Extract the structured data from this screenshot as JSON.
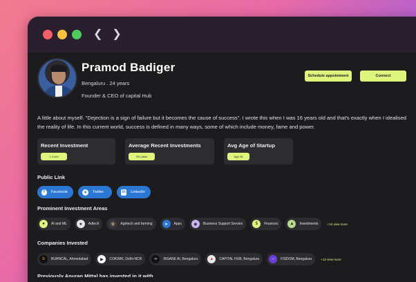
{
  "profile": {
    "name": "Pramod Badiger",
    "meta": "Bengaluru . 24 years",
    "role": "Founder & CEO of capital Hub"
  },
  "actions": {
    "schedule_label": "Schedule appointment",
    "connect_label": "Connect"
  },
  "bio": "A little about myself. \"Dejection is a sign of failure but it becomes the cause of success\". I wrote this when I was 16 years old and that's exactly when I idealised the reality of life. In this current world, success is defined in many ways, some of which include money, fame and power.",
  "stats": [
    {
      "label": "Recent Investment",
      "value": "1 Crore"
    },
    {
      "label": "Average Recent Investments",
      "value": "25 Lakhs"
    },
    {
      "label": "Avg Age of Startup",
      "value": "Age 25"
    }
  ],
  "public_link": {
    "title": "Public Link",
    "items": [
      {
        "label": "Facebook",
        "icon": "facebook-icon"
      },
      {
        "label": "Twitter",
        "icon": "twitter-icon"
      },
      {
        "label": "LinkedIn",
        "icon": "linkedin-icon"
      }
    ]
  },
  "investment_areas": {
    "title": "Prominent Investment Areas",
    "items": [
      {
        "label": "AI and ML",
        "icon": "ai-icon",
        "color": "#ddf57b"
      },
      {
        "label": "Adtech",
        "icon": "adtech-icon",
        "color": "#e6e6ea"
      },
      {
        "label": "Agritech and farming",
        "icon": "agritech-icon",
        "color": "#3a3a40"
      },
      {
        "label": "Apps",
        "icon": "apps-icon",
        "color": "#2a78d4"
      },
      {
        "label": "Business Support Servies",
        "icon": "business-icon",
        "color": "#c8b4f0"
      },
      {
        "label": "Finances",
        "icon": "finances-icon",
        "color": "#ddf57b"
      },
      {
        "label": "Investments",
        "icon": "investments-icon",
        "color": "#b9d98a"
      }
    ],
    "more": "+10 view more"
  },
  "companies": {
    "title": "Companies Invested",
    "items": [
      {
        "label": "BURNCAL, Ahmedabad",
        "icon": "burncal-icon",
        "color": "#f2a13c"
      },
      {
        "label": "COKWIK, Delhi-NCR",
        "icon": "cokwik-icon",
        "color": "#ffffff"
      },
      {
        "label": "INSANE AI, Bengaluru",
        "icon": "insane-ai-icon",
        "color": "#111111"
      },
      {
        "label": "CAPITAL HUB, Bengaluru",
        "icon": "capital-hub-icon",
        "color": "#e8e8ea"
      },
      {
        "label": "FISDOM, Bengaluru",
        "icon": "fisdom-icon",
        "color": "#6b3fd6"
      }
    ],
    "more": "+12 view more"
  },
  "partial_heading": "Previously Anurag Mittal has invested in it with"
}
